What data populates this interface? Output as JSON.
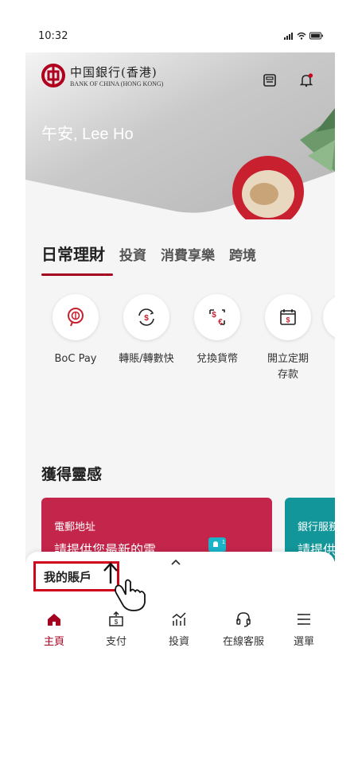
{
  "status_bar": {
    "time": "10:32"
  },
  "header": {
    "bank_name_cn": "中国銀行(香港)",
    "bank_name_en": "BANK OF CHINA (HONG KONG)",
    "greeting": "午安, Lee Ho"
  },
  "tabs": [
    {
      "label": "日常理財",
      "active": true
    },
    {
      "label": "投資",
      "active": false
    },
    {
      "label": "消費享樂",
      "active": false
    },
    {
      "label": "跨境",
      "active": false
    }
  ],
  "quick_actions": [
    {
      "label": "BoC Pay",
      "icon": "boc-pay-icon"
    },
    {
      "label": "轉賬/轉數快",
      "icon": "transfer-icon"
    },
    {
      "label": "兌換貨幣",
      "icon": "currency-exchange-icon"
    },
    {
      "label": "開立定期存款",
      "icon": "time-deposit-icon"
    }
  ],
  "inspiration": {
    "title": "獲得靈感",
    "cards": [
      {
        "title": "電郵地址",
        "subtitle": "請提供您最新的電"
      },
      {
        "title": "銀行服務",
        "subtitle": "請提供"
      }
    ]
  },
  "drawer": {
    "label": "我的賬戶"
  },
  "bottom_nav": [
    {
      "label": "主頁",
      "icon": "home-icon",
      "active": true
    },
    {
      "label": "支付",
      "icon": "payment-icon",
      "active": false
    },
    {
      "label": "投資",
      "icon": "investment-icon",
      "active": false
    },
    {
      "label": "在線客服",
      "icon": "headset-icon",
      "active": false
    },
    {
      "label": "選單",
      "icon": "menu-icon",
      "active": false
    }
  ],
  "colors": {
    "brand": "#a4001f",
    "card_red": "#c4254b",
    "card_teal": "#12969a"
  }
}
